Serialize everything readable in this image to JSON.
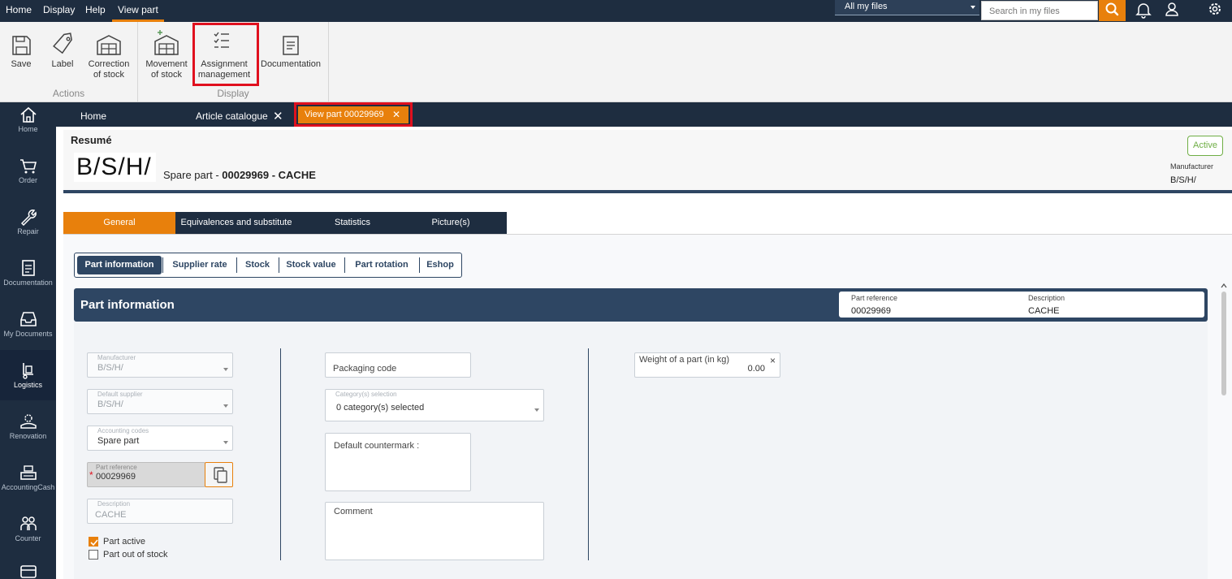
{
  "topmenu": {
    "items": [
      "Home",
      "Display",
      "Help",
      "View part"
    ],
    "scope": "All my files",
    "search_placeholder": "Search in my files"
  },
  "ribbon": {
    "save": "Save",
    "label": "Label",
    "correction_1": "Correction",
    "correction_2": "of stock",
    "movement_1": "Movement",
    "movement_2": "of stock",
    "assignment_1": "Assignment",
    "assignment_2": "management",
    "documentation": "Documentation",
    "group_actions": "Actions",
    "group_display": "Display"
  },
  "sidebar": {
    "items": [
      "Home",
      "Order",
      "Repair",
      "Documentation",
      "My Documents",
      "Logistics",
      "Renovation",
      "AccountingCash",
      "Counter"
    ]
  },
  "doc_tabs": {
    "home": "Home",
    "catalogue": "Article catalogue",
    "view_part": "View part 00029969"
  },
  "resume": {
    "title": "Resumé",
    "logo_text": "B/S/H/",
    "type": "Spare part - ",
    "ref_desc": "00029969 - CACHE",
    "status": "Active",
    "manufacturer_label": "Manufacturer",
    "manufacturer_value": "B/S/H/"
  },
  "general_tabs": [
    "General",
    "Equivalences and substitute",
    "Statistics",
    "Picture(s)"
  ],
  "sub_tabs": [
    "Part information",
    "Supplier rate",
    "Stock",
    "Stock value",
    "Part rotation",
    "Eshop"
  ],
  "part_info": {
    "title": "Part information",
    "ref_label": "Part reference",
    "ref_value": "00029969",
    "desc_label": "Description",
    "desc_value": "CACHE"
  },
  "form": {
    "manufacturer_label": "Manufacturer",
    "manufacturer_value": "B/S/H/",
    "supplier_label": "Default supplier",
    "supplier_value": "B/S/H/",
    "accounting_label": "Accounting codes",
    "accounting_value": "Spare part",
    "partref_label": "Part reference",
    "partref_value": "00029969",
    "description_label": "Description",
    "description_value": "CACHE",
    "part_active": "Part active",
    "part_out_of_stock": "Part out of stock",
    "packaging_code": "Packaging code",
    "category_label": "Category(s) selection",
    "category_value": "0 category(s) selected",
    "countermark": "Default countermark :",
    "comment": "Comment",
    "weight_label": "Weight of a part (in kg)",
    "weight_value": "0.00",
    "clear": "×"
  },
  "colors": {
    "accent": "#e8800c",
    "navy": "#1e2d40",
    "panel": "#2e4663",
    "active_green": "#6fae45",
    "highlight": "#e0101e"
  }
}
